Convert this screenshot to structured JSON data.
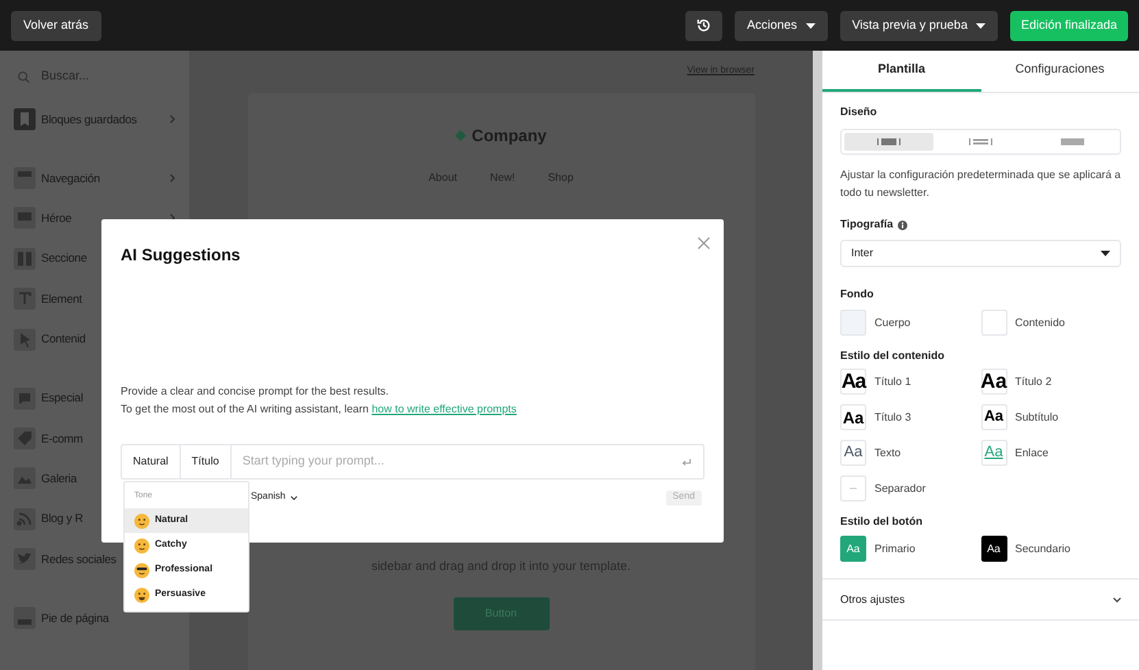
{
  "top_bar": {
    "back_button": "Volver atrás",
    "menus": [
      {
        "label": "Acciones"
      },
      {
        "label": "Vista previa y prueba"
      }
    ],
    "finish_button": "Edición finalizada"
  },
  "sidebar": {
    "search": {
      "placeholder": "Buscar..."
    },
    "groups": [
      [
        {
          "label": "Bloques guardados",
          "arrow": true
        }
      ],
      [
        {
          "label": "Navegación",
          "arrow": true
        },
        {
          "label": "Héroe",
          "arrow": true
        },
        {
          "label": "Seccione"
        },
        {
          "label": "Element"
        },
        {
          "label": "Contenid"
        }
      ],
      [
        {
          "label": "Especial"
        },
        {
          "label": "E-comm"
        },
        {
          "label": "Galeria"
        },
        {
          "label": "Blog y R"
        },
        {
          "label": "Redes sociales"
        }
      ],
      [
        {
          "label": "Pie de página"
        }
      ]
    ]
  },
  "canvas": {
    "view_link": "View in browser",
    "brand": "Company",
    "nav": [
      "About",
      "New!",
      "Shop"
    ],
    "body_text": "sidebar and drag and drop it into your template.",
    "cta_button": "Button"
  },
  "modal": {
    "title": "AI Suggestions",
    "hint": "Provide a clear and concise prompt for the best results.",
    "help_text": "To get the most out of the AI writing assistant, learn",
    "help_link": "how to write effective prompts",
    "tone_button": "Natural",
    "format_button": "Título",
    "prompt": {
      "placeholder": "Start typing your prompt..."
    },
    "language": "Spanish",
    "send_button": "Send",
    "tone_menu": {
      "heading": "Tone",
      "options": [
        {
          "label": "Natural",
          "selected": true
        },
        {
          "label": "Catchy",
          "selected": false
        },
        {
          "label": "Professional",
          "selected": false
        },
        {
          "label": "Persuasive",
          "selected": false
        }
      ]
    }
  },
  "panel": {
    "tabs": [
      {
        "label": "Plantilla",
        "selected": true
      },
      {
        "label": "Configuraciones",
        "selected": false
      }
    ],
    "design": {
      "title": "Diseño",
      "layouts": [
        {
          "selected": true
        },
        {
          "selected": false
        },
        {
          "selected": false
        }
      ],
      "description": "Ajustar la configuración predeterminada que se aplicará a todo tu newsletter."
    },
    "typography": {
      "title": "Tipografía",
      "value": "Inter"
    },
    "background": {
      "title": "Fondo",
      "swatches": [
        {
          "label": "Cuerpo",
          "color": "#f1f5f9"
        },
        {
          "label": "Contenido",
          "color": "#ffffff"
        }
      ]
    },
    "content_style": {
      "title": "Estilo del contenido",
      "items": [
        {
          "kind": "heading1",
          "sample": "Aa",
          "label": "Título 1"
        },
        {
          "kind": "heading2",
          "sample": "Aa",
          "label": "Título 2"
        },
        {
          "kind": "heading3",
          "sample": "Aa",
          "label": "Título 3"
        },
        {
          "kind": "subtitle",
          "sample": "Aa",
          "label": "Subtítulo"
        },
        {
          "kind": "body",
          "sample": "Aa",
          "label": "Texto"
        },
        {
          "kind": "link",
          "sample": "Aa",
          "label": "Enlace"
        },
        {
          "kind": "divider",
          "label": "Separador"
        }
      ]
    },
    "button_style": {
      "title": "Estilo del botón",
      "items": [
        {
          "kind": "primary",
          "sample": "Aa",
          "label": "Primario"
        },
        {
          "kind": "secondary",
          "sample": "Aa",
          "label": "Secundario"
        }
      ]
    },
    "other_settings": {
      "label": "Otros ajustes",
      "expanded": false
    }
  }
}
